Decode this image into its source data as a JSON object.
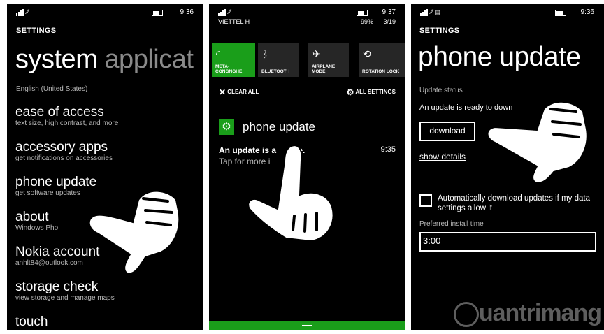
{
  "panel1": {
    "time": "9:36",
    "header": "SETTINGS",
    "pivot_active": "system",
    "pivot_next": "applicat",
    "language_text": "English (United States)",
    "items": [
      {
        "title": "ease of access",
        "subtitle": "text size, high contrast, and more"
      },
      {
        "title": "accessory apps",
        "subtitle": "get notifications on accessories"
      },
      {
        "title": "phone update",
        "subtitle": "get software updates"
      },
      {
        "title": "about",
        "subtitle": "Windows Pho"
      },
      {
        "title": "Nokia account",
        "subtitle": "anhlt84@outlook.com"
      },
      {
        "title": "storage check",
        "subtitle": "view storage and manage maps"
      },
      {
        "title": "touch",
        "subtitle": ""
      }
    ]
  },
  "panel2": {
    "carrier": "VIETTEL H",
    "battery_pct": "99%",
    "time": "9:37",
    "date": "3/19",
    "tiles": [
      {
        "label": "META-\nCONGNGHE",
        "icon": "wifi-icon",
        "active": true
      },
      {
        "label": "BLUETOOTH",
        "icon": "bluetooth-icon",
        "active": false
      },
      {
        "label": "AIRPLANE\nMODE",
        "icon": "airplane-icon",
        "active": false
      },
      {
        "label": "ROTATION LOCK",
        "icon": "rotation-lock-icon",
        "active": false
      }
    ],
    "clear_all": "CLEAR ALL",
    "all_settings": "ALL SETTINGS",
    "notification_app": "phone update",
    "notification_title": "An update is a",
    "notification_title_end": "le.",
    "notification_time": "9:35",
    "notification_body": "Tap for more i",
    "accent_color": "#1a9e1a"
  },
  "panel3": {
    "time": "9:36",
    "header": "SETTINGS",
    "title": "phone update",
    "status_label": "Update status",
    "status_text": "An update is ready to down",
    "download_label": "download",
    "show_details": "show details",
    "auto_download_label": "Automatically download updates if my data settings allow it",
    "preferred_time_label": "Preferred install time",
    "preferred_time_value": "3:00"
  },
  "watermark": "uantrimang"
}
